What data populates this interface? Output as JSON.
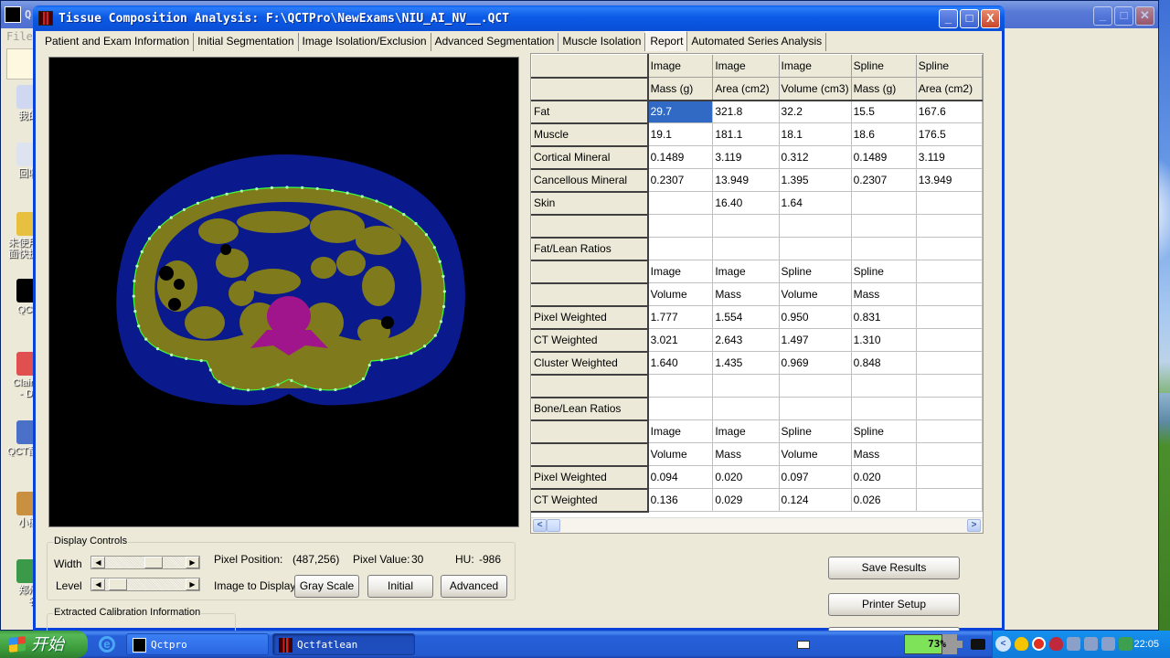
{
  "desktop": {
    "icons": [
      {
        "label": "我的"
      },
      {
        "label": "回收"
      },
      {
        "label": "未使用\n面快捷"
      },
      {
        "label": "QCT"
      },
      {
        "label": "Claim\n- Dr."
      },
      {
        "label": "QCT配"
      },
      {
        "label": "小熊"
      },
      {
        "label": "郑州\n名"
      }
    ]
  },
  "background_window": {
    "title": "Q",
    "menu_file": "File"
  },
  "window": {
    "title": "Tissue Composition Analysis: F:\\QCTPro\\NewExams\\NIU_AI_NV__.QCT",
    "minimize": "_",
    "maximize": "□",
    "close": "X"
  },
  "tabs": [
    {
      "label": "Patient and Exam Information",
      "active": false
    },
    {
      "label": "Initial Segmentation",
      "active": false
    },
    {
      "label": "Image Isolation/Exclusion",
      "active": false
    },
    {
      "label": "Advanced Segmentation",
      "active": false
    },
    {
      "label": "Muscle Isolation",
      "active": false
    },
    {
      "label": "Report",
      "active": true
    },
    {
      "label": "Automated Series Analysis",
      "active": false
    }
  ],
  "display_controls": {
    "legend": "Display Controls",
    "width_label": "Width",
    "level_label": "Level",
    "width_slider_fraction": 0.62,
    "level_slider_fraction": 0.05,
    "pixel_position_label": "Pixel Position:",
    "pixel_position_value": "(487,256)",
    "pixel_value_label": "Pixel Value:",
    "pixel_value": "30",
    "hu_label": "HU:",
    "hu_value": "-986",
    "image_to_display_label": "Image to Display:",
    "buttons": {
      "gray_scale": "Gray Scale",
      "initial": "Initial",
      "advanced": "Advanced"
    }
  },
  "calibration": {
    "legend": "Extracted Calibration Information"
  },
  "report_grid": {
    "header1": [
      "",
      "Image",
      "Image",
      "Image",
      "Spline",
      "Spline"
    ],
    "header2": [
      "",
      "Mass (g)",
      "Area (cm2)",
      "Volume (cm3)",
      "Mass (g)",
      "Area (cm2)"
    ],
    "rows": [
      {
        "label": "Fat",
        "cells": [
          "29.7",
          "321.8",
          "32.2",
          "15.5",
          "167.6"
        ],
        "selected_col": 0
      },
      {
        "label": "Muscle",
        "cells": [
          "19.1",
          "181.1",
          "18.1",
          "18.6",
          "176.5"
        ]
      },
      {
        "label": "Cortical Mineral",
        "cells": [
          "0.1489",
          "3.119",
          "0.312",
          "0.1489",
          "3.119"
        ]
      },
      {
        "label": "Cancellous Mineral",
        "cells": [
          "0.2307",
          "13.949",
          "1.395",
          "0.2307",
          "13.949"
        ]
      },
      {
        "label": "Skin",
        "cells": [
          "",
          "16.40",
          "1.64",
          "",
          ""
        ]
      },
      {
        "label": "",
        "cells": [
          "",
          "",
          "",
          "",
          ""
        ]
      },
      {
        "label": "Fat/Lean Ratios",
        "cells": [
          "",
          "",
          "",
          "",
          ""
        ]
      },
      {
        "label": "",
        "cells": [
          "Image",
          "Image",
          "Spline",
          "Spline",
          ""
        ]
      },
      {
        "label": "",
        "cells": [
          "Volume",
          "Mass",
          "Volume",
          "Mass",
          ""
        ]
      },
      {
        "label": "Pixel Weighted",
        "cells": [
          "1.777",
          "1.554",
          "0.950",
          "0.831",
          ""
        ]
      },
      {
        "label": "CT Weighted",
        "cells": [
          "3.021",
          "2.643",
          "1.497",
          "1.310",
          ""
        ]
      },
      {
        "label": "Cluster Weighted",
        "cells": [
          "1.640",
          "1.435",
          "0.969",
          "0.848",
          ""
        ]
      },
      {
        "label": "",
        "cells": [
          "",
          "",
          "",
          "",
          ""
        ]
      },
      {
        "label": "Bone/Lean Ratios",
        "cells": [
          "",
          "",
          "",
          "",
          ""
        ]
      },
      {
        "label": "",
        "cells": [
          "Image",
          "Image",
          "Spline",
          "Spline",
          ""
        ]
      },
      {
        "label": "",
        "cells": [
          "Volume",
          "Mass",
          "Volume",
          "Mass",
          ""
        ]
      },
      {
        "label": "Pixel Weighted",
        "cells": [
          "0.094",
          "0.020",
          "0.097",
          "0.020",
          ""
        ]
      },
      {
        "label": "CT Weighted",
        "cells": [
          "0.136",
          "0.029",
          "0.124",
          "0.026",
          ""
        ]
      }
    ],
    "scroll_left": "<",
    "scroll_right": ">"
  },
  "actions": {
    "save_results": "Save Results",
    "printer_setup": "Printer Setup"
  },
  "segmentation_colors": {
    "background": "#000000",
    "subcutaneous_fat": "#0a1a8c",
    "muscle_organs": "#7f7a1c",
    "bone": "#a0148c",
    "spline_contour": "#3cff3c"
  },
  "taskbar": {
    "start_label": "开始",
    "tasks": [
      {
        "label": "Qctpro",
        "active": false
      },
      {
        "label": "Qctfatlean",
        "active": true
      }
    ],
    "battery_percent": 73,
    "battery_label": "73%",
    "tray_chevron": "<",
    "clock": "22:05"
  }
}
